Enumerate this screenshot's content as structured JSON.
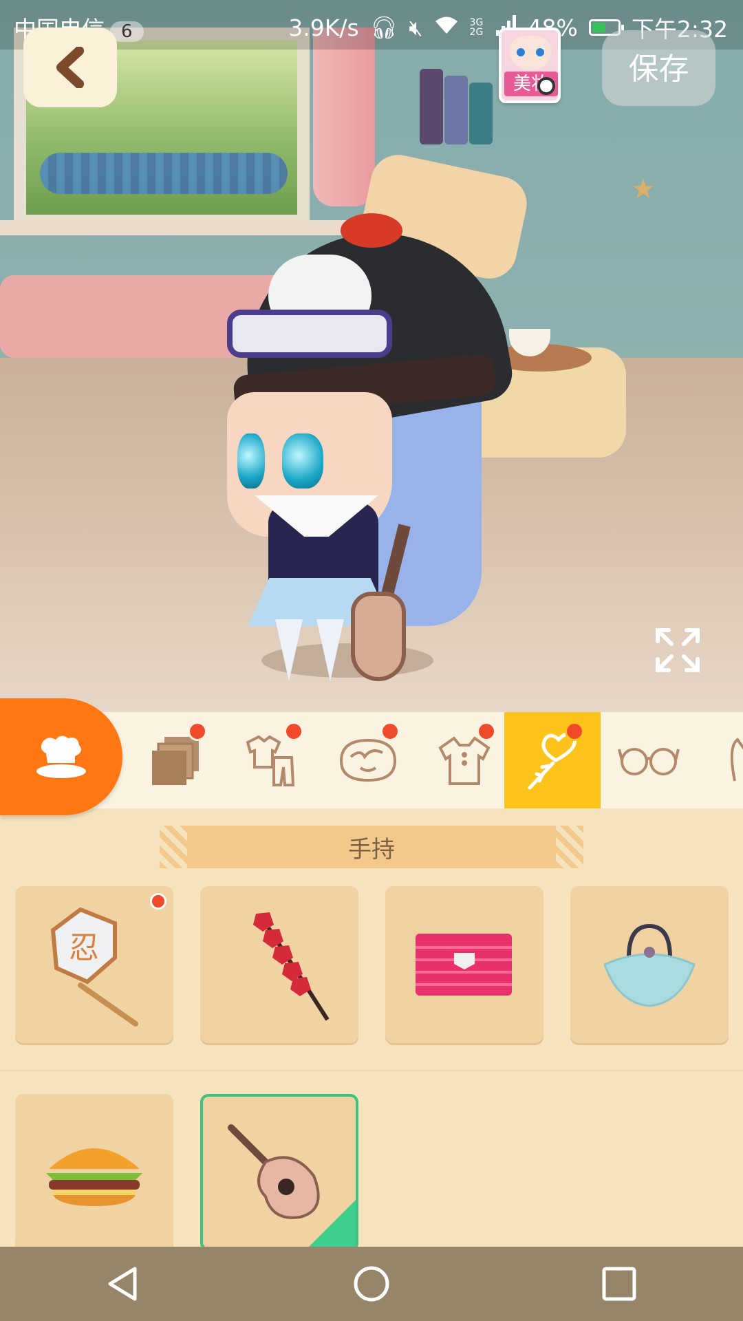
{
  "status_bar": {
    "carrier": "中国电信",
    "sim_badge": "6",
    "net_speed": "3.9K/s",
    "network": "3G 2G",
    "battery": "48%",
    "time": "下午2:32"
  },
  "top_bar": {
    "save_label": "保存",
    "makeup_label": "美妆"
  },
  "category_tabs": [
    {
      "name": "outfit-sets",
      "icon": "layers-icon",
      "badge": true,
      "active": false
    },
    {
      "name": "outfit",
      "icon": "clothes-set-icon",
      "badge": true,
      "active": false
    },
    {
      "name": "face",
      "icon": "face-icon",
      "badge": true,
      "active": false
    },
    {
      "name": "top",
      "icon": "shirt-icon",
      "badge": true,
      "active": false
    },
    {
      "name": "handheld",
      "icon": "lollipop-heart-icon",
      "badge": true,
      "active": true
    },
    {
      "name": "glasses",
      "icon": "glasses-icon",
      "badge": false,
      "active": false
    },
    {
      "name": "ears",
      "icon": "cat-ear-icon",
      "badge": false,
      "active": false
    }
  ],
  "section": {
    "title": "手持"
  },
  "items": [
    {
      "name": "fan",
      "icon": "paper-fan-icon",
      "badge": true,
      "selected": false
    },
    {
      "name": "candied-haws",
      "icon": "candied-haws-icon",
      "badge": false,
      "selected": false
    },
    {
      "name": "wallet",
      "icon": "pink-wallet-icon",
      "badge": false,
      "selected": false
    },
    {
      "name": "handbag",
      "icon": "shell-bag-icon",
      "badge": false,
      "selected": false
    },
    {
      "name": "burger",
      "icon": "burger-icon",
      "badge": false,
      "selected": false
    },
    {
      "name": "guitar",
      "icon": "guitar-icon",
      "badge": false,
      "selected": true
    }
  ],
  "colors": {
    "accent_orange": "#ff7713",
    "active_tab": "#fcc41a",
    "badge_red": "#f04a2b",
    "selected_green": "#3fce8e"
  }
}
